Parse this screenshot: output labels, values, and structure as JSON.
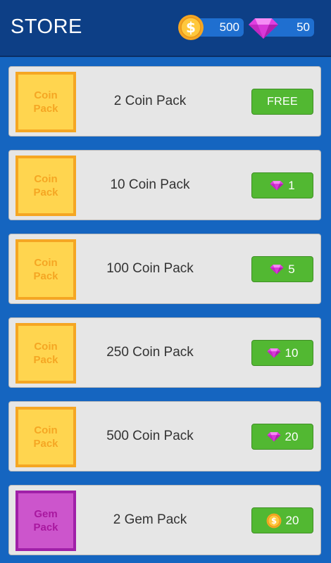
{
  "header": {
    "title": "STORE",
    "coins": "500",
    "gems": "50"
  },
  "icons": {
    "coin": "coin-icon",
    "gem": "gem-icon"
  },
  "colors": {
    "background": "#1565c0",
    "header": "#0d3f86",
    "buy_button": "#52b832",
    "coin_pack": "#ffd54f",
    "gem_pack": "#cc55cc",
    "gem": "#e040e0"
  },
  "items": [
    {
      "thumb_line1": "Coin",
      "thumb_line2": "Pack",
      "name": "2 Coin Pack",
      "price": "FREE",
      "currency": "none"
    },
    {
      "thumb_line1": "Coin",
      "thumb_line2": "Pack",
      "name": "10 Coin Pack",
      "price": "1",
      "currency": "gem"
    },
    {
      "thumb_line1": "Coin",
      "thumb_line2": "Pack",
      "name": "100 Coin Pack",
      "price": "5",
      "currency": "gem"
    },
    {
      "thumb_line1": "Coin",
      "thumb_line2": "Pack",
      "name": "250 Coin Pack",
      "price": "10",
      "currency": "gem"
    },
    {
      "thumb_line1": "Coin",
      "thumb_line2": "Pack",
      "name": "500 Coin Pack",
      "price": "20",
      "currency": "gem"
    },
    {
      "thumb_line1": "Gem",
      "thumb_line2": "Pack",
      "name": "2 Gem Pack",
      "price": "20",
      "currency": "coin"
    }
  ]
}
